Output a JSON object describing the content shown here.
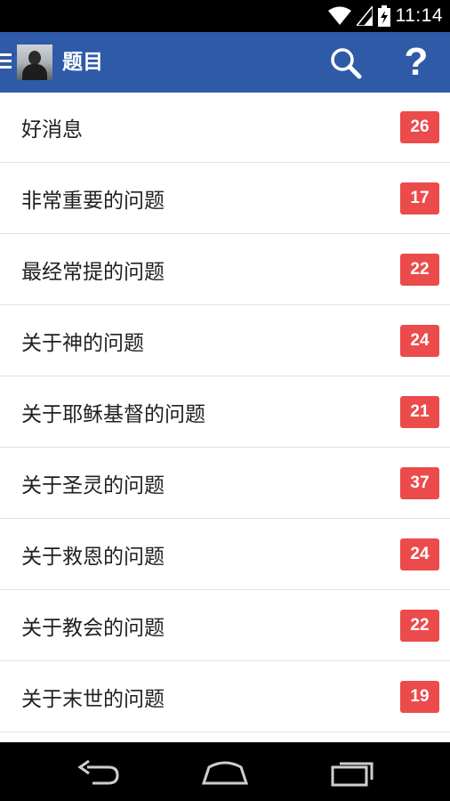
{
  "status_bar": {
    "time": "11:14",
    "icons": [
      "wifi-icon",
      "signal-icon",
      "battery-charging-icon"
    ]
  },
  "action_bar": {
    "title": "题目",
    "menu_icon": "hamburger-icon",
    "avatar_icon": "avatar-image",
    "search_icon": "search-icon",
    "help_label": "?",
    "color": "#2f5aa8"
  },
  "topics": [
    {
      "label": "好消息",
      "count": "26"
    },
    {
      "label": "非常重要的问题",
      "count": "17"
    },
    {
      "label": "最经常提的问题",
      "count": "22"
    },
    {
      "label": "关于神的问题",
      "count": "24"
    },
    {
      "label": "关于耶稣基督的问题",
      "count": "21"
    },
    {
      "label": "关于圣灵的问题",
      "count": "37"
    },
    {
      "label": "关于救恩的问题",
      "count": "24"
    },
    {
      "label": "关于教会的问题",
      "count": "22"
    },
    {
      "label": "关于末世的问题",
      "count": "19"
    }
  ],
  "badge_color": "#ec4b4b",
  "nav_bar": {
    "icons": [
      "back-icon",
      "home-icon",
      "recent-apps-icon"
    ]
  }
}
